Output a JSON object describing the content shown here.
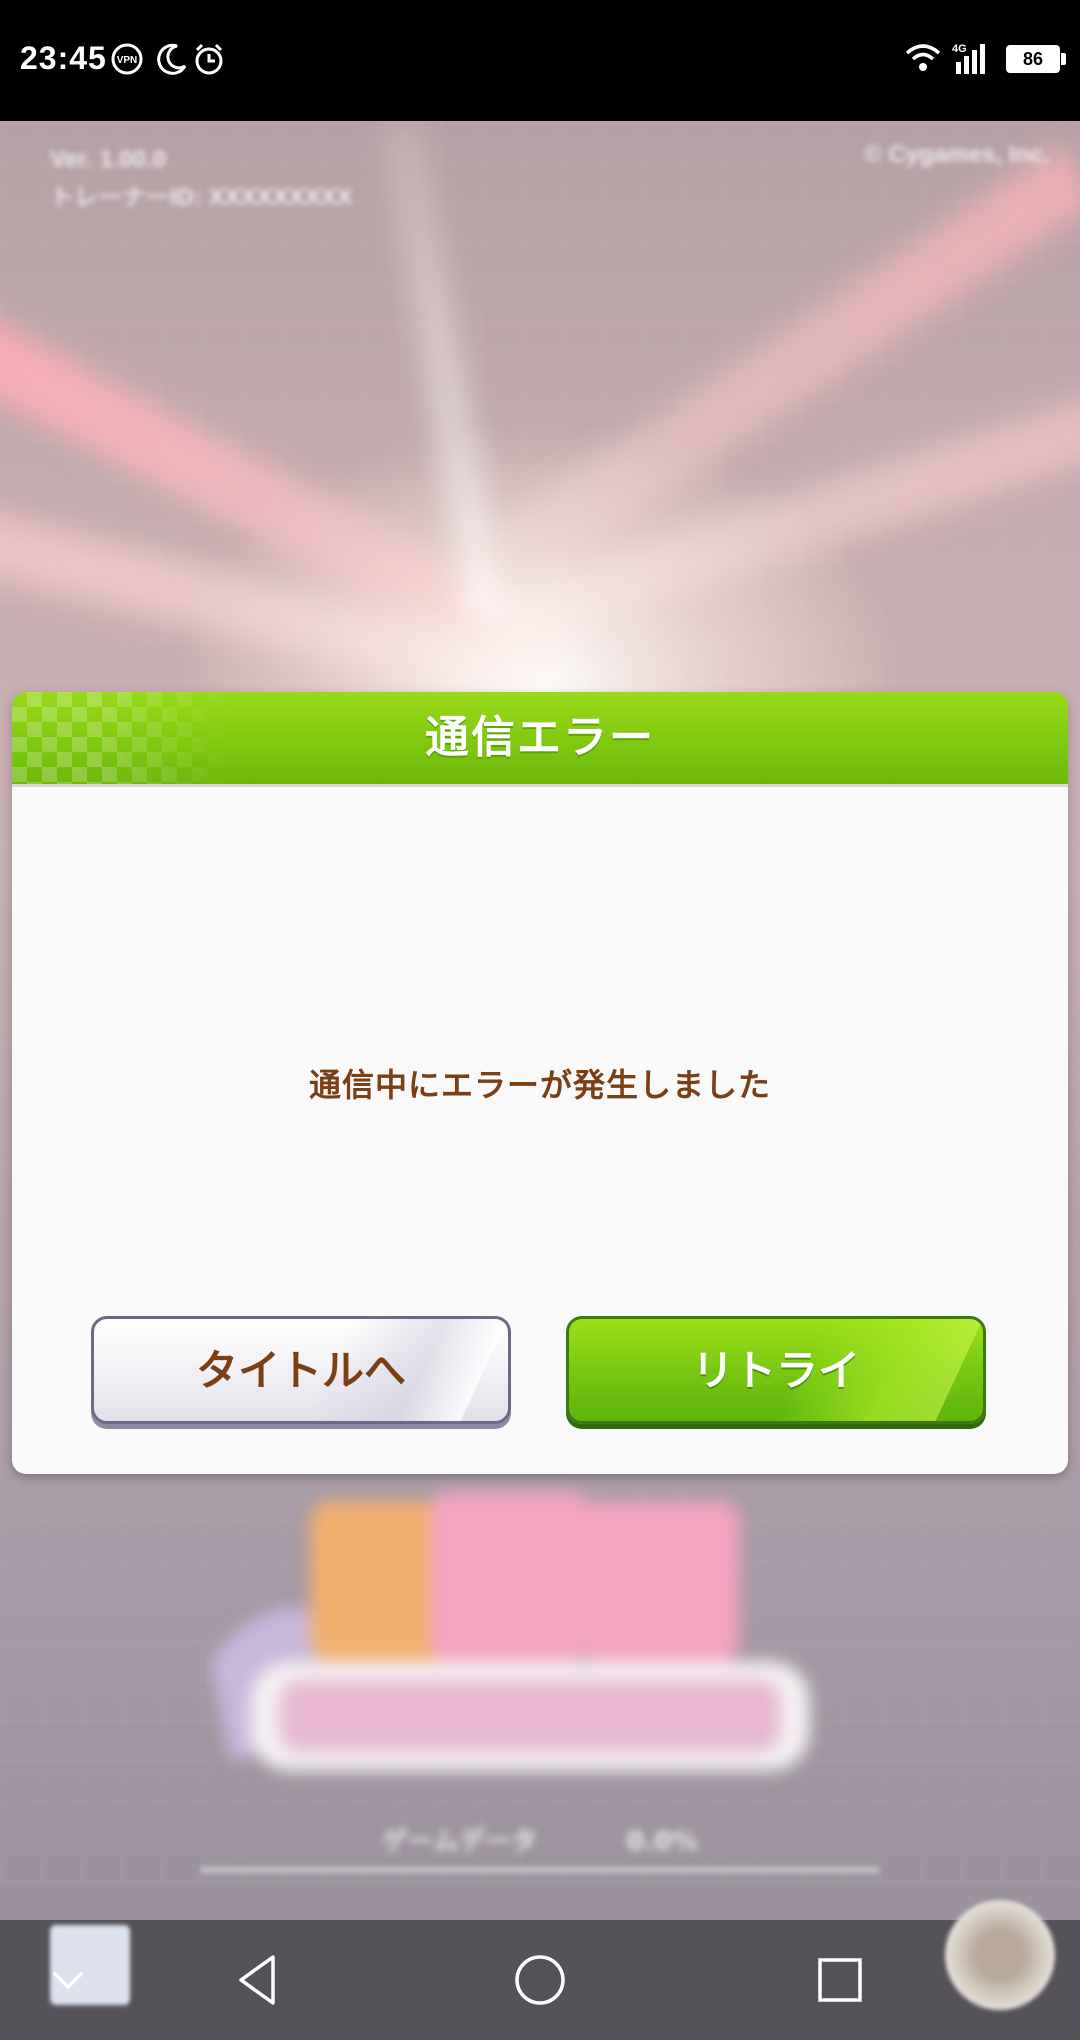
{
  "status_bar": {
    "time": "23:45",
    "icons": [
      "vpn-icon",
      "moon-icon",
      "alarm-icon",
      "wifi-icon",
      "signal-icon"
    ],
    "network": "4G",
    "battery": "86"
  },
  "game_screen": {
    "version_line1": "Ver. 1.00.0",
    "version_line2": "トレーナーID: XXXXXXXXX",
    "copyright": "© Cygames, Inc.",
    "bottom_left": "ゲームデータ",
    "bottom_right": "0.0%"
  },
  "dialog": {
    "title": "通信エラー",
    "message": "通信中にエラーが発生しました",
    "buttons": {
      "title_label": "タイトルへ",
      "retry_label": "リトライ"
    },
    "colors": {
      "header": "#7cc70f",
      "message_text": "#7a3f14",
      "retry_button": "#78c812"
    }
  },
  "nav_bar": {
    "buttons": [
      "chevron-down-icon",
      "back-icon",
      "home-icon",
      "recents-icon"
    ]
  }
}
